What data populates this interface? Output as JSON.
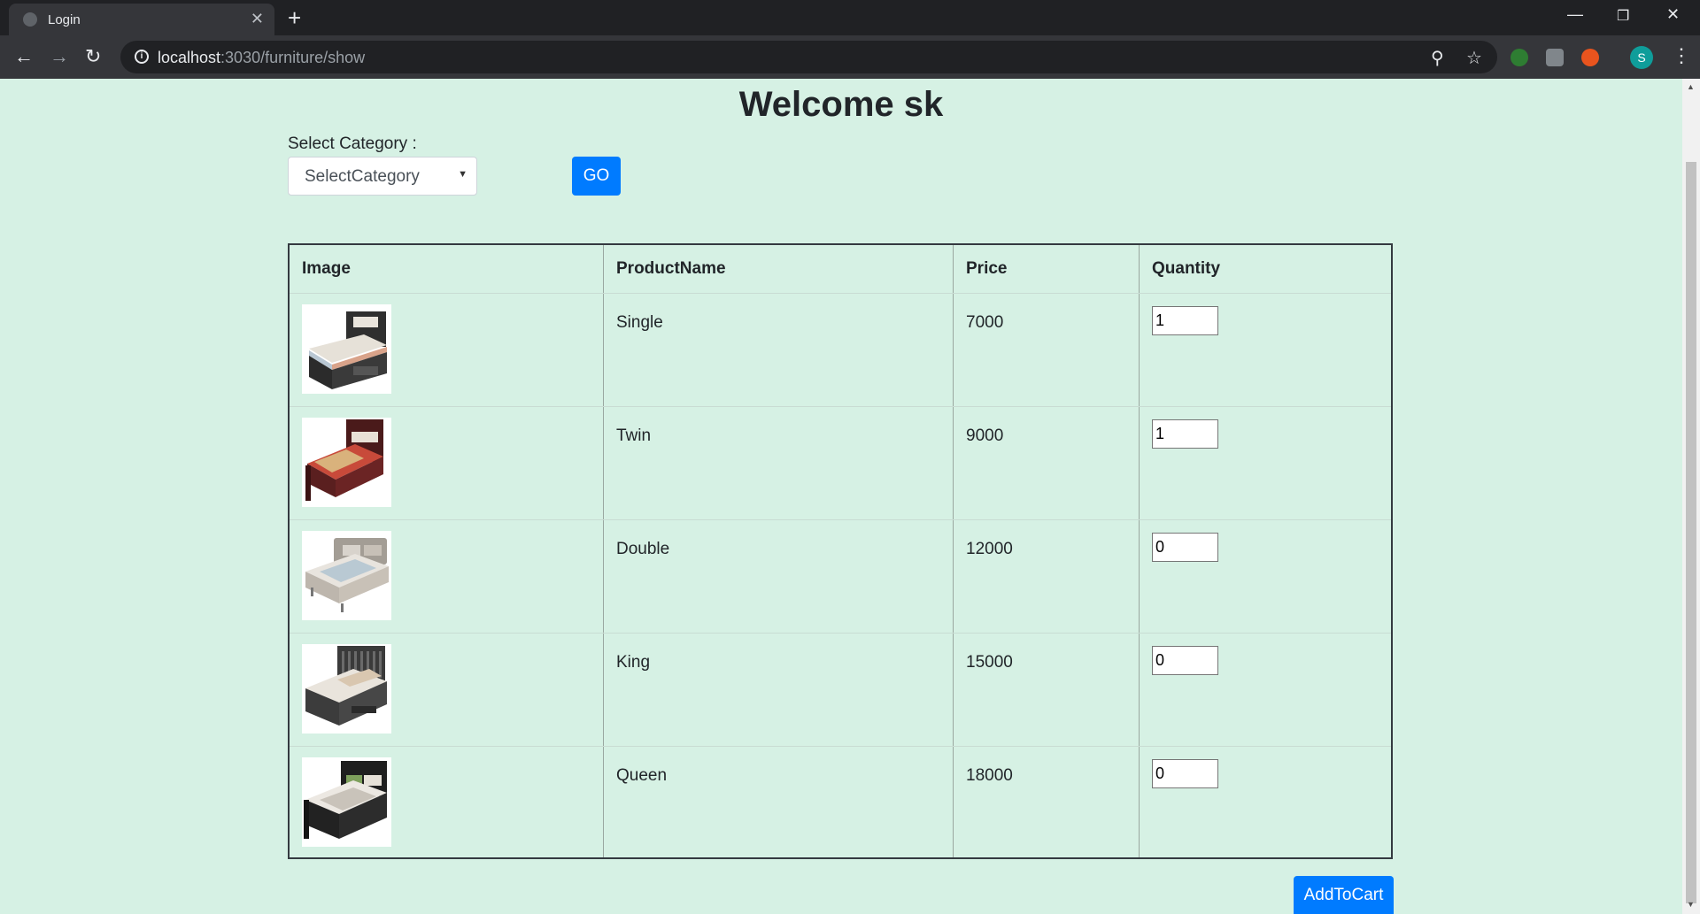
{
  "browser": {
    "tab_title": "Login",
    "url_host": "localhost",
    "url_path": ":3030/furniture/show",
    "profile_initial": "S"
  },
  "page": {
    "title": "Welcome sk",
    "category_label": "Select Category :",
    "category_selected": "SelectCategory",
    "go_label": "GO",
    "add_to_cart_label": "AddToCart"
  },
  "table": {
    "headers": [
      "Image",
      "ProductName",
      "Price",
      "Quantity"
    ],
    "rows": [
      {
        "name": "Single",
        "price": "7000",
        "quantity": "1",
        "image_icon": "single-bed-icon"
      },
      {
        "name": "Twin",
        "price": "9000",
        "quantity": "1",
        "image_icon": "twin-bed-icon"
      },
      {
        "name": "Double",
        "price": "12000",
        "quantity": "0",
        "image_icon": "double-bed-icon"
      },
      {
        "name": "King",
        "price": "15000",
        "quantity": "0",
        "image_icon": "king-bed-icon"
      },
      {
        "name": "Queen",
        "price": "18000",
        "quantity": "0",
        "image_icon": "queen-bed-icon"
      }
    ]
  },
  "colors": {
    "page_background": "#d6f1e4",
    "primary_button": "#007bff"
  }
}
